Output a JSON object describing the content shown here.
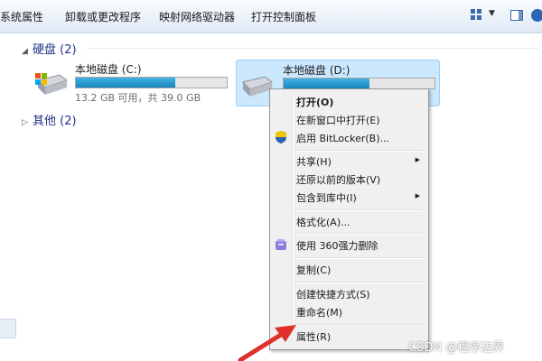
{
  "toolbar": {
    "items": [
      "系统属性",
      "卸载或更改程序",
      "映射网络驱动器",
      "打开控制面板"
    ]
  },
  "groups": {
    "hard_disks": "硬盘 (2)",
    "other": "其他 (2)"
  },
  "drives": [
    {
      "name": "本地磁盘 (C:)",
      "space": "13.2 GB 可用，共 39.0 GB",
      "used_fraction": 0.66
    },
    {
      "name": "本地磁盘 (D:)",
      "used_fraction": 0.57
    }
  ],
  "context_menu": {
    "items": [
      {
        "label": "打开(O)",
        "bold": true
      },
      {
        "label": "在新窗口中打开(E)"
      },
      {
        "label": "启用 BitLocker(B)...",
        "icon": "shield-icon"
      },
      {
        "label": "共享(H)",
        "submenu": true
      },
      {
        "label": "还原以前的版本(V)"
      },
      {
        "label": "包含到库中(I)",
        "submenu": true
      },
      {
        "label": "格式化(A)..."
      },
      {
        "label": "使用 360强力删除",
        "icon": "360-icon"
      },
      {
        "label": "复制(C)"
      },
      {
        "label": "创建快捷方式(S)"
      },
      {
        "label": "重命名(M)"
      },
      {
        "label": "属性(R)"
      }
    ]
  },
  "colors": {
    "group_title": "#1e3287",
    "selection": "#cce8ff",
    "bar_fill": "#1a86bf",
    "annotation_arrow": "#e0302a"
  },
  "watermark": "CSDN @程序边界"
}
